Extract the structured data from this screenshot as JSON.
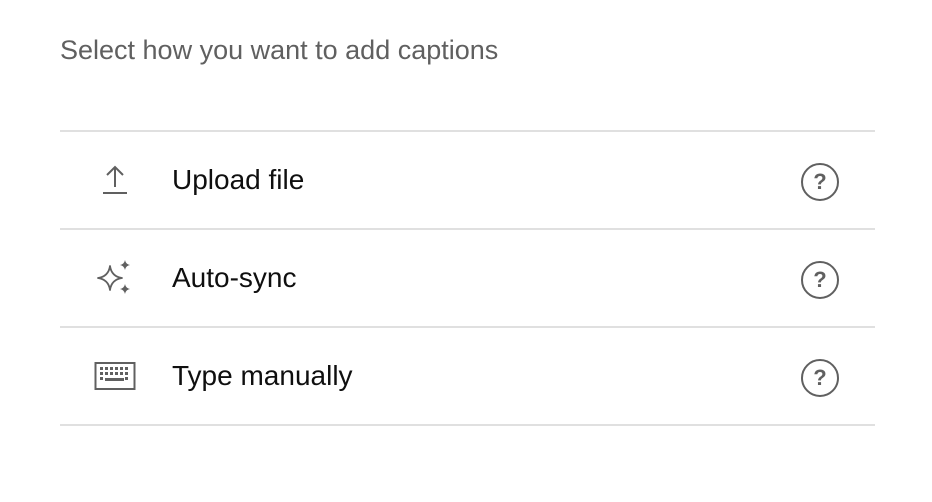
{
  "prompt": "Select how you want to add captions",
  "options": [
    {
      "label": "Upload file",
      "icon": "upload-icon",
      "help_icon": "help-icon"
    },
    {
      "label": "Auto-sync",
      "icon": "sparkle-icon",
      "help_icon": "help-icon"
    },
    {
      "label": "Type manually",
      "icon": "keyboard-icon",
      "help_icon": "help-icon"
    }
  ],
  "help_glyph": "?",
  "colors": {
    "text_primary": "#0f0f0f",
    "text_secondary": "#606060",
    "divider": "#e0e0e0"
  }
}
